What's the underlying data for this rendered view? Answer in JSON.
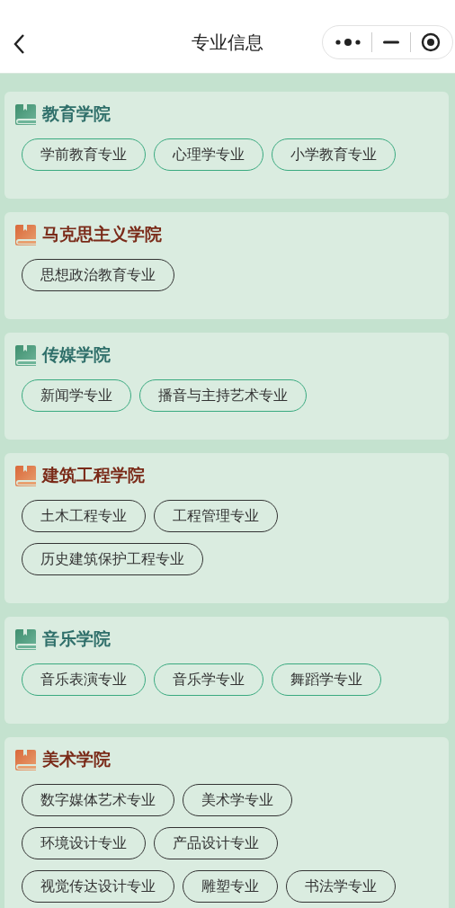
{
  "nav": {
    "title": "专业信息"
  },
  "colleges": [
    {
      "name": "教育学院",
      "kind": "green",
      "majors": [
        "学前教育专业",
        "心理学专业",
        "小学教育专业"
      ]
    },
    {
      "name": "马克思主义学院",
      "kind": "orange",
      "majors": [
        "思想政治教育专业"
      ]
    },
    {
      "name": "传媒学院",
      "kind": "green",
      "majors": [
        "新闻学专业",
        "播音与主持艺术专业"
      ]
    },
    {
      "name": "建筑工程学院",
      "kind": "orange",
      "majors": [
        "土木工程专业",
        "工程管理专业",
        "历史建筑保护工程专业"
      ]
    },
    {
      "name": "音乐学院",
      "kind": "green",
      "majors": [
        "音乐表演专业",
        "音乐学专业",
        "舞蹈学专业"
      ]
    },
    {
      "name": "美术学院",
      "kind": "orange",
      "majors": [
        "数字媒体艺术专业",
        "美术学专业",
        "环境设计专业",
        "产品设计专业",
        "视觉传达设计专业",
        "雕塑专业",
        "书法学专业"
      ]
    }
  ]
}
